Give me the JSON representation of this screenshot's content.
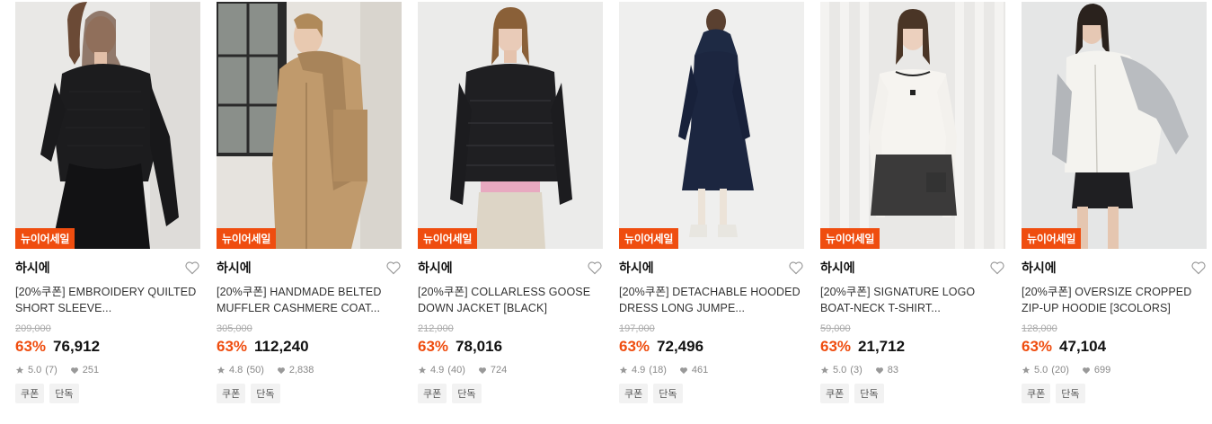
{
  "products": [
    {
      "badge": "뉴이어세일",
      "brand": "하시에",
      "name": "[20%쿠폰] EMBROIDERY QUILTED SHORT SLEEVE...",
      "original_price": "209,000",
      "discount": "63%",
      "price": "76,912",
      "rating": "5.0",
      "reviews": "(7)",
      "likes": "251",
      "tags": [
        "쿠폰",
        "단독"
      ]
    },
    {
      "badge": "뉴이어세일",
      "brand": "하시에",
      "name": "[20%쿠폰] HANDMADE BELTED MUFFLER CASHMERE COAT...",
      "original_price": "305,000",
      "discount": "63%",
      "price": "112,240",
      "rating": "4.8",
      "reviews": "(50)",
      "likes": "2,838",
      "tags": [
        "쿠폰",
        "단독"
      ]
    },
    {
      "badge": "뉴이어세일",
      "brand": "하시에",
      "name": "[20%쿠폰] COLLARLESS GOOSE DOWN JACKET [BLACK]",
      "original_price": "212,000",
      "discount": "63%",
      "price": "78,016",
      "rating": "4.9",
      "reviews": "(40)",
      "likes": "724",
      "tags": [
        "쿠폰",
        "단독"
      ]
    },
    {
      "badge": "뉴이어세일",
      "brand": "하시에",
      "name": "[20%쿠폰] DETACHABLE HOODED DRESS LONG JUMPE...",
      "original_price": "197,000",
      "discount": "63%",
      "price": "72,496",
      "rating": "4.9",
      "reviews": "(18)",
      "likes": "461",
      "tags": [
        "쿠폰",
        "단독"
      ]
    },
    {
      "badge": "뉴이어세일",
      "brand": "하시에",
      "name": "[20%쿠폰] SIGNATURE LOGO BOAT-NECK T-SHIRT...",
      "original_price": "59,000",
      "discount": "63%",
      "price": "21,712",
      "rating": "5.0",
      "reviews": "(3)",
      "likes": "83",
      "tags": [
        "쿠폰",
        "단독"
      ]
    },
    {
      "badge": "뉴이어세일",
      "brand": "하시에",
      "name": "[20%쿠폰] OVERSIZE CROPPED ZIP-UP HOODIE [3COLORS]",
      "original_price": "128,000",
      "discount": "63%",
      "price": "47,104",
      "rating": "5.0",
      "reviews": "(20)",
      "likes": "699",
      "tags": [
        "쿠폰",
        "단독"
      ]
    }
  ],
  "colors": {
    "accent": "#ef4d0f",
    "muted": "#aaaaaa"
  },
  "icons": {
    "like": "heart-outline-icon",
    "rating": "star-icon",
    "likes": "heart-filled-icon"
  }
}
